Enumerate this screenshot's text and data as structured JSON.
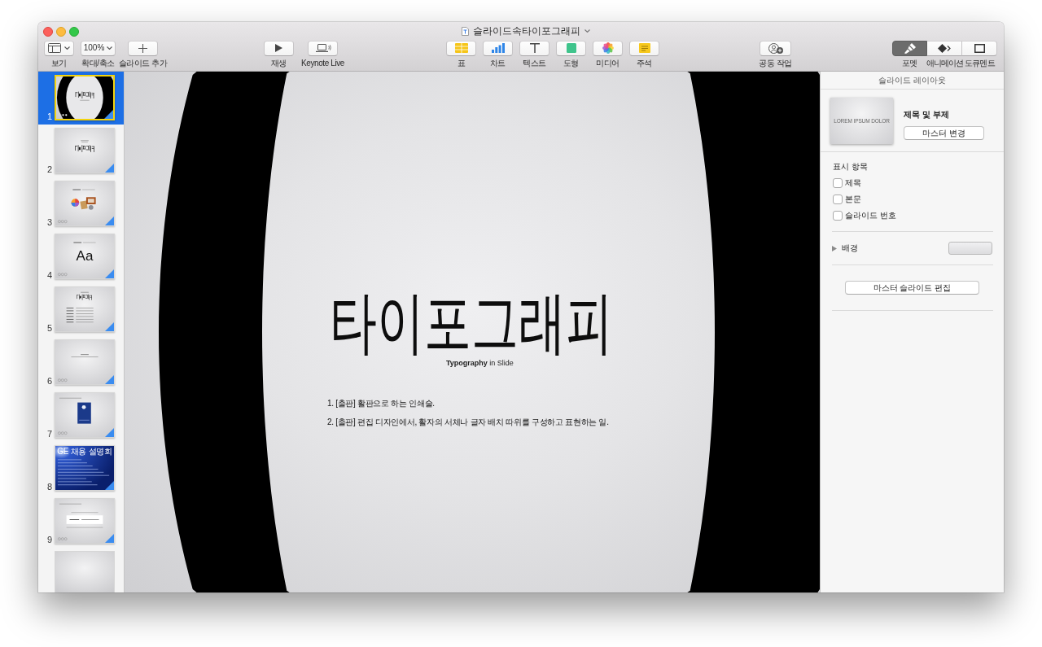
{
  "window": {
    "title": "슬라이드속타이포그래피"
  },
  "toolbar": {
    "left": [
      {
        "kind": "view",
        "label": "보기"
      },
      {
        "kind": "zoom",
        "value": "100%",
        "label": "확대/축소"
      },
      {
        "kind": "add",
        "label": "슬라이드 추가"
      }
    ],
    "playback": [
      {
        "kind": "play",
        "label": "재생"
      },
      {
        "kind": "live",
        "label": "Keynote Live"
      }
    ],
    "insert": [
      {
        "kind": "table",
        "label": "표"
      },
      {
        "kind": "chart",
        "label": "차트"
      },
      {
        "kind": "text",
        "label": "텍스트"
      },
      {
        "kind": "shape",
        "label": "도형"
      },
      {
        "kind": "media",
        "label": "미디어"
      },
      {
        "kind": "comment",
        "label": "주석"
      }
    ],
    "share": [
      {
        "kind": "collaborate",
        "label": "공동 작업"
      }
    ],
    "inspector_tabs": [
      {
        "kind": "format",
        "label": "포멧",
        "selected": true
      },
      {
        "kind": "animate",
        "label": "애니메이션",
        "selected": false
      },
      {
        "kind": "document",
        "label": "도큐멘트",
        "selected": false
      }
    ]
  },
  "slides": [
    {
      "number": "1",
      "kind": "ring",
      "selected": true,
      "build": true
    },
    {
      "number": "2",
      "kind": "wordmark",
      "selected": false,
      "build": true
    },
    {
      "number": "3",
      "kind": "collage",
      "selected": false,
      "build": true
    },
    {
      "number": "4",
      "kind": "glyph",
      "text": "Aa",
      "selected": false,
      "build": true
    },
    {
      "number": "5",
      "kind": "list",
      "selected": false,
      "build": true
    },
    {
      "number": "6",
      "kind": "caption",
      "selected": false,
      "build": true
    },
    {
      "number": "7",
      "kind": "photo",
      "selected": false,
      "build": true
    },
    {
      "number": "8",
      "kind": "banner",
      "text": "GE 채용 설명회",
      "selected": false,
      "build": true
    },
    {
      "number": "9",
      "kind": "quote",
      "selected": false,
      "build": true
    },
    {
      "kind": "blank",
      "selected": false,
      "build": false
    }
  ],
  "slide": {
    "title": "타이포그래피",
    "subtitle": "**Typography** in Slide",
    "items": [
      "1. [출판] 활판으로 하는 인쇄술.",
      "2. [출판] 편집 디자인에서, 활자의 서체나 글자 배치 따위를 구성하고 표현하는 일."
    ]
  },
  "inspector": {
    "title": "슬라이드 레이아웃",
    "layout": {
      "preview_text": "LOREM IPSUM DOLOR",
      "name": "제목 및 부제",
      "button": "마스터 변경"
    },
    "show": {
      "heading": "표시 항목",
      "options": [
        {
          "label": "제목",
          "checked": false
        },
        {
          "label": "본문",
          "checked": false
        },
        {
          "label": "슬라이드 번호",
          "checked": false
        }
      ]
    },
    "background": {
      "label": "배경",
      "expanded": false
    },
    "edit_button": "마스터 슬라이드 편집"
  }
}
